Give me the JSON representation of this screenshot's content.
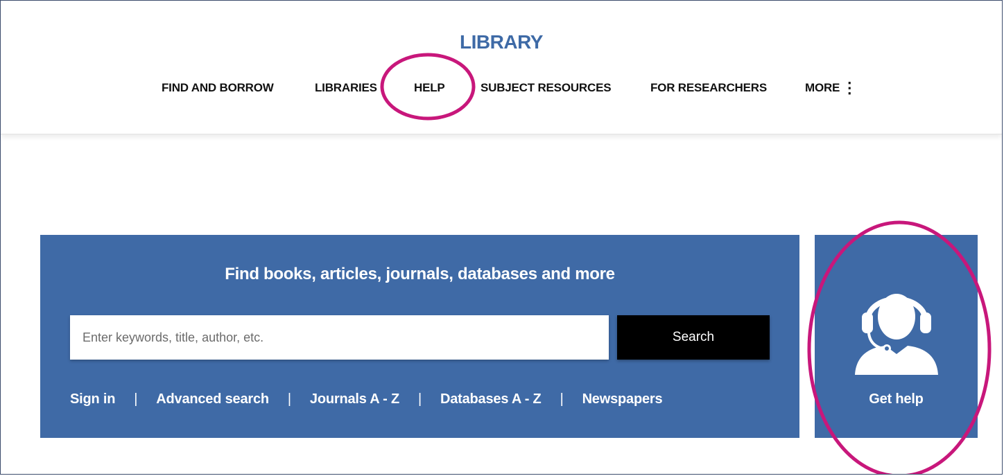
{
  "header": {
    "site_title": "LIBRARY",
    "nav": [
      {
        "label": "FIND AND BORROW"
      },
      {
        "label": "LIBRARIES"
      },
      {
        "label": "HELP"
      },
      {
        "label": "SUBJECT RESOURCES"
      },
      {
        "label": "FOR RESEARCHERS"
      },
      {
        "label": "MORE"
      }
    ]
  },
  "search": {
    "heading": "Find books, articles, journals, databases and more",
    "placeholder": "Enter keywords, title, author, etc.",
    "value": "",
    "button_label": "Search",
    "links": [
      {
        "label": "Sign in"
      },
      {
        "label": "Advanced search"
      },
      {
        "label": "Journals A - Z"
      },
      {
        "label": "Databases A - Z"
      },
      {
        "label": "Newspapers"
      }
    ],
    "separator": "|"
  },
  "help_card": {
    "icon": "headset-person-icon",
    "label": "Get help"
  },
  "colors": {
    "brand_blue": "#3f6aa6",
    "annotation_magenta": "#c8177b",
    "button_black": "#000000"
  }
}
